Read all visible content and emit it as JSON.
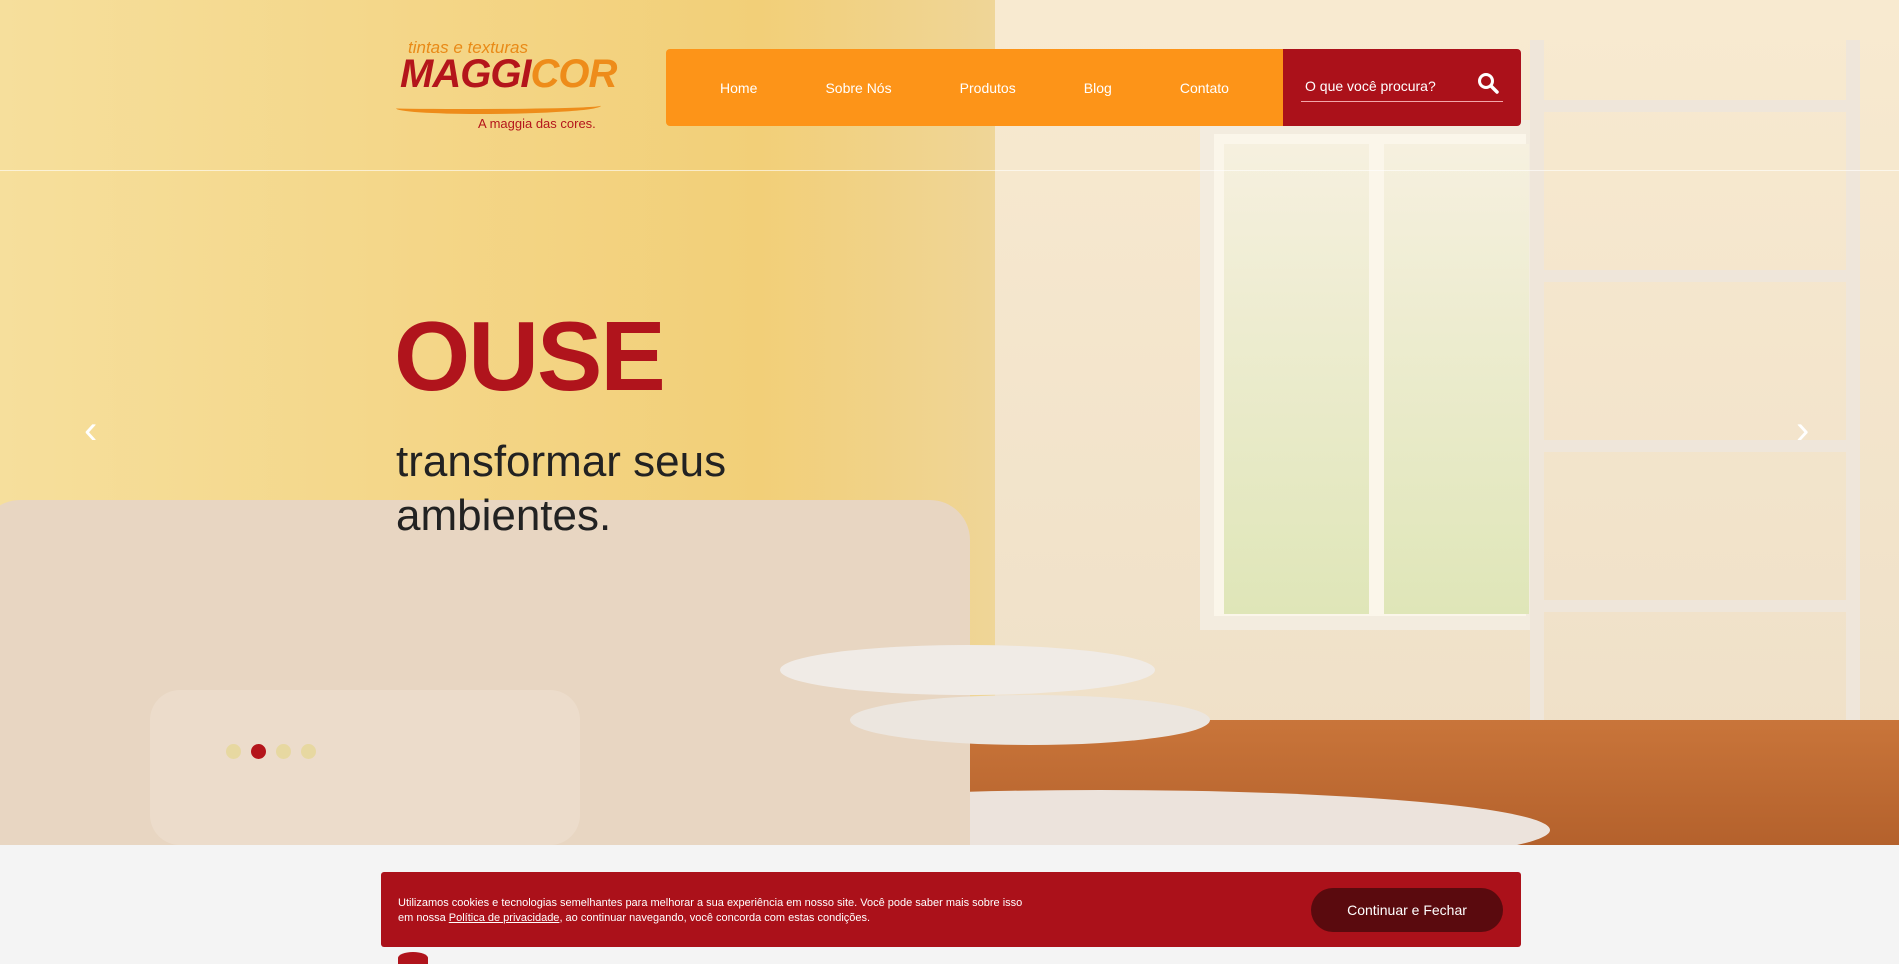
{
  "logo": {
    "tagline_top": "tintas e texturas",
    "name_part1": "MAGGI",
    "name_part2": "COR",
    "slogan": "A maggia das cores."
  },
  "nav": {
    "items": [
      {
        "label": "Home"
      },
      {
        "label": "Sobre Nós"
      },
      {
        "label": "Produtos"
      },
      {
        "label": "Blog"
      },
      {
        "label": "Contato"
      }
    ]
  },
  "search": {
    "placeholder": "O que você procura?",
    "icon": "search-icon"
  },
  "hero": {
    "headline": "OUSE",
    "subtitle": "transformar seus ambientes.",
    "prev": "‹",
    "next": "›",
    "slides": 4,
    "active_slide": 2
  },
  "cookie": {
    "text_before": "Utilizamos cookies e tecnologias semelhantes para melhorar a sua experiência em nosso site. Você pode saber mais sobre isso em nossa ",
    "link": "Política de privacidade",
    "text_after": ", ao continuar navegando, você concorda com estas condições.",
    "button": "Continuar e Fechar"
  },
  "colors": {
    "orange": "#fd9418",
    "red": "#ab111a",
    "dark_red": "#5a0a0e"
  }
}
